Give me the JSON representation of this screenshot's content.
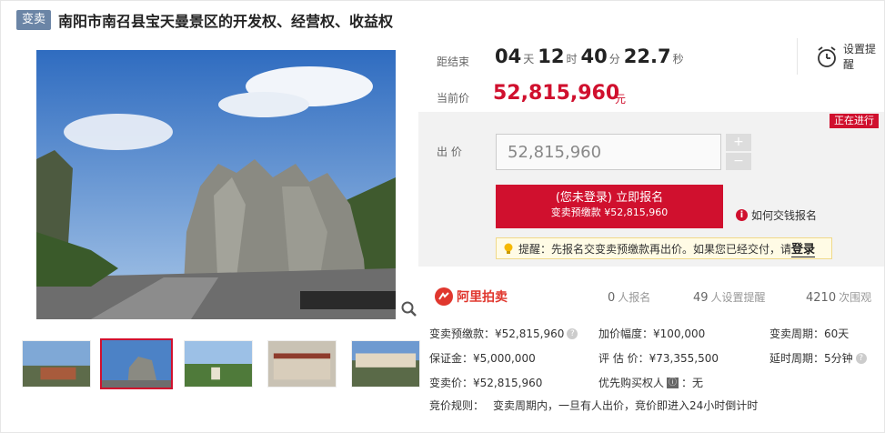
{
  "header": {
    "badge": "变卖",
    "title": "南阳市南召县宝天曼景区的开发权、经营权、收益权"
  },
  "timer": {
    "label": "距结束",
    "days": "04",
    "days_unit": "天",
    "hours": "12",
    "hours_unit": "时",
    "minutes": "40",
    "minutes_unit": "分",
    "seconds": "22.7",
    "seconds_unit": "秒"
  },
  "reminder": {
    "label": "设置提醒",
    "icon": "alarm-clock-icon"
  },
  "price": {
    "label": "当前价",
    "value": "52,815,960",
    "unit": "元"
  },
  "bid": {
    "status": "正在进行",
    "label": "出 价",
    "input_value": "52,815,960",
    "plus": "+",
    "minus": "−",
    "signup_main": "(您未登录) 立即报名",
    "signup_sub": "变卖预缴款 ¥52,815,960",
    "howpay": "如何交钱报名",
    "notice_text": "提醒：先报名交变卖预缴款再出价。如果您已经交付，请",
    "notice_link": "登录"
  },
  "stats": {
    "logo": "阿里拍卖",
    "signups": "0",
    "signups_label": "人报名",
    "reminders": "49",
    "reminders_label": "人设置提醒",
    "views": "4210",
    "views_label": "次围观"
  },
  "info": {
    "deposit": "变卖预缴款：¥52,815,960",
    "increment": "加价幅度：¥100,000",
    "period": "变卖周期：60天",
    "bond": "保证金：¥5,000,000",
    "appraisal": "评 估 价：¥73,355,500",
    "delay": "延时周期：5分钟",
    "sale_price": "变卖价：¥52,815,960",
    "priority_label": "优先购买权人",
    "priority_badge": "ⓘ",
    "priority_value": "：无",
    "rules_label": "竞价规则：",
    "rules_text": "变卖周期内，一旦有人出价，竞价即进入24小时倒计时"
  },
  "colors": {
    "accent": "#d0102e",
    "badge": "#6b85a6",
    "panel": "#f2f2f2"
  }
}
